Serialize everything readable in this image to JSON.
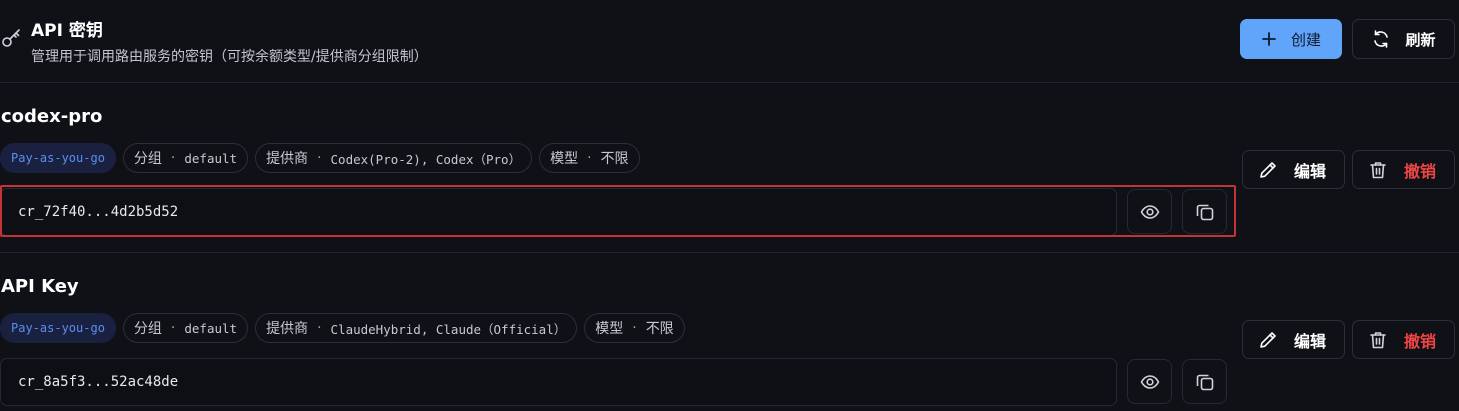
{
  "header": {
    "title": "API 密钥",
    "subtitle": "管理用于调用路由服务的密钥（可按余额类型/提供商分组限制）",
    "create_label": "创建",
    "refresh_label": "刷新",
    "title_icon": "key-icon"
  },
  "keys": [
    {
      "name": "codex-pro",
      "billing": "Pay-as-you-go",
      "group_label": "分组",
      "group_value": "default",
      "provider_label": "提供商",
      "provider_value": "Codex(Pro-2), Codex（Pro）",
      "model_label": "模型",
      "model_value": "不限",
      "masked_key": "cr_72f40...4d2b5d52",
      "edit_label": "编辑",
      "revoke_label": "撤销"
    },
    {
      "name": "API Key",
      "billing": "Pay-as-you-go",
      "group_label": "分组",
      "group_value": "default",
      "provider_label": "提供商",
      "provider_value": "ClaudeHybrid, Claude（Official）",
      "model_label": "模型",
      "model_value": "不限",
      "masked_key": "cr_8a5f3...52ac48de",
      "edit_label": "编辑",
      "revoke_label": "撤销"
    }
  ],
  "colors": {
    "background": "#0f1117",
    "accent": "#60a5fa",
    "danger": "#ef4444",
    "billing_tag_text": "#5b8ef0",
    "highlight_border": "#c53434"
  }
}
